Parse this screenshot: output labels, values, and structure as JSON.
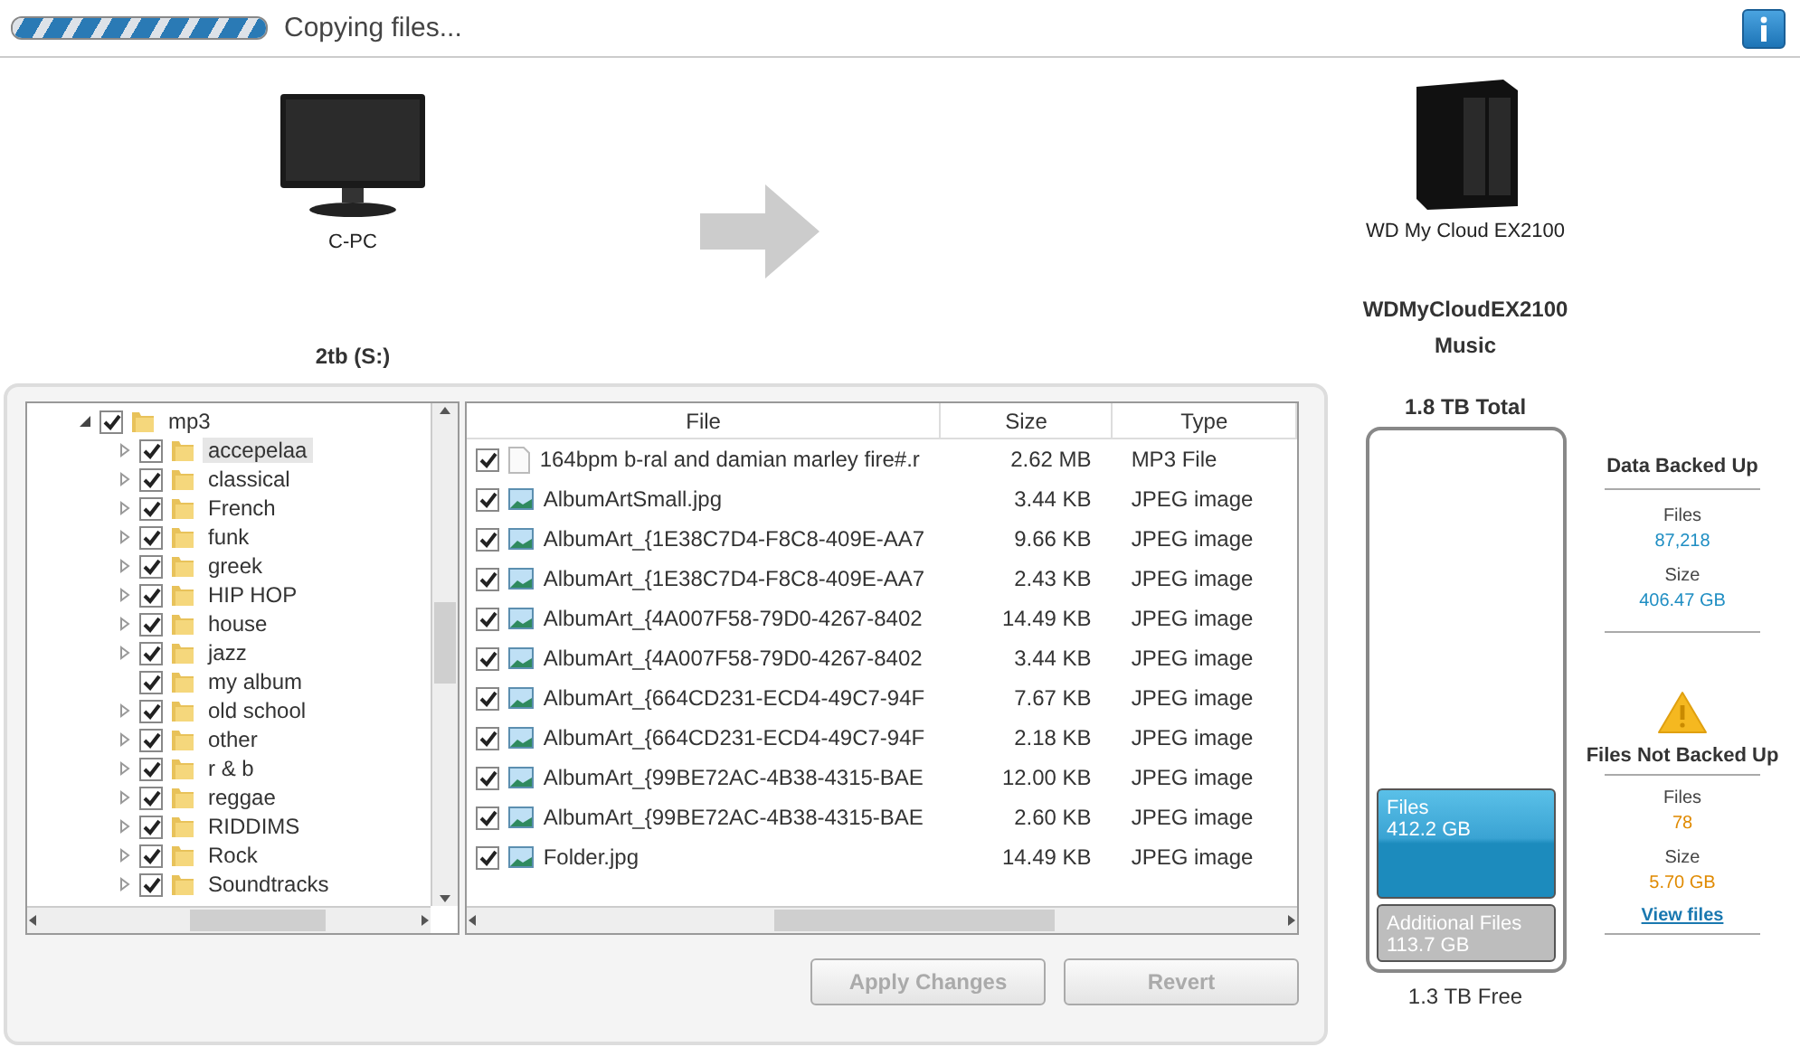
{
  "status": {
    "text": "Copying files...",
    "level": 1
  },
  "source": {
    "name": "C-PC",
    "drive": "2tb (S:)"
  },
  "target": {
    "name": "WD My Cloud EX2100",
    "share_host": "WDMyCloudEX2100",
    "share": "Music"
  },
  "tree": [
    {
      "label": "mp3",
      "checked": true,
      "expanded": true,
      "selected": false,
      "children": [
        {
          "label": "accepelaa",
          "checked": true,
          "expandable": true,
          "selected": true
        },
        {
          "label": "classical",
          "checked": true,
          "expandable": true,
          "selected": false
        },
        {
          "label": "French",
          "checked": true,
          "expandable": true,
          "selected": false
        },
        {
          "label": "funk",
          "checked": true,
          "expandable": true,
          "selected": false
        },
        {
          "label": "greek",
          "checked": true,
          "expandable": true,
          "selected": false
        },
        {
          "label": "HIP HOP",
          "checked": true,
          "expandable": true,
          "selected": false
        },
        {
          "label": "house",
          "checked": true,
          "expandable": true,
          "selected": false
        },
        {
          "label": "jazz",
          "checked": true,
          "expandable": true,
          "selected": false
        },
        {
          "label": "my album",
          "checked": true,
          "expandable": false,
          "selected": false
        },
        {
          "label": "old school",
          "checked": true,
          "expandable": true,
          "selected": false
        },
        {
          "label": "other",
          "checked": true,
          "expandable": true,
          "selected": false
        },
        {
          "label": "r & b",
          "checked": true,
          "expandable": true,
          "selected": false
        },
        {
          "label": "reggae",
          "checked": true,
          "expandable": true,
          "selected": false
        },
        {
          "label": "RIDDIMS",
          "checked": true,
          "expandable": true,
          "selected": false
        },
        {
          "label": "Rock",
          "checked": true,
          "expandable": true,
          "selected": false
        },
        {
          "label": "Soundtracks",
          "checked": true,
          "expandable": true,
          "selected": false
        }
      ]
    }
  ],
  "table": {
    "columns": [
      "File",
      "Size",
      "Type"
    ],
    "rows": [
      {
        "kind": "audio",
        "checked": true,
        "name": "164bpm b-ral and damian marley fire#.r",
        "size": "2.62 MB",
        "type": "MP3 File"
      },
      {
        "kind": "image",
        "checked": true,
        "name": "AlbumArtSmall.jpg",
        "size": "3.44 KB",
        "type": "JPEG image"
      },
      {
        "kind": "image",
        "checked": true,
        "name": "AlbumArt_{1E38C7D4-F8C8-409E-AA7",
        "size": "9.66 KB",
        "type": "JPEG image"
      },
      {
        "kind": "image",
        "checked": true,
        "name": "AlbumArt_{1E38C7D4-F8C8-409E-AA7",
        "size": "2.43 KB",
        "type": "JPEG image"
      },
      {
        "kind": "image",
        "checked": true,
        "name": "AlbumArt_{4A007F58-79D0-4267-8402",
        "size": "14.49 KB",
        "type": "JPEG image"
      },
      {
        "kind": "image",
        "checked": true,
        "name": "AlbumArt_{4A007F58-79D0-4267-8402",
        "size": "3.44 KB",
        "type": "JPEG image"
      },
      {
        "kind": "image",
        "checked": true,
        "name": "AlbumArt_{664CD231-ECD4-49C7-94F",
        "size": "7.67 KB",
        "type": "JPEG image"
      },
      {
        "kind": "image",
        "checked": true,
        "name": "AlbumArt_{664CD231-ECD4-49C7-94F",
        "size": "2.18 KB",
        "type": "JPEG image"
      },
      {
        "kind": "image",
        "checked": true,
        "name": "AlbumArt_{99BE72AC-4B38-4315-BAE",
        "size": "12.00 KB",
        "type": "JPEG image"
      },
      {
        "kind": "image",
        "checked": true,
        "name": "AlbumArt_{99BE72AC-4B38-4315-BAE",
        "size": "2.60 KB",
        "type": "JPEG image"
      },
      {
        "kind": "image",
        "checked": true,
        "name": "Folder.jpg",
        "size": "14.49 KB",
        "type": "JPEG image"
      }
    ]
  },
  "buttons": [
    {
      "label": "Apply Changes",
      "disabled": true
    },
    {
      "label": "Revert",
      "disabled": true
    }
  ],
  "storage": {
    "total": "1.8 TB Total",
    "free": "1.3 TB Free",
    "segments": [
      {
        "kind": "files",
        "label": "Files",
        "value": "412.2 GB",
        "level": 0.21
      },
      {
        "kind": "additional",
        "label": "Additional Files",
        "value": "113.7 GB",
        "level": 0.11
      }
    ]
  },
  "backed_up": {
    "title": "Data Backed Up",
    "files_label": "Files",
    "files": "87,218",
    "size_label": "Size",
    "size": "406.47 GB"
  },
  "not_backed_up": {
    "title": "Files Not Backed Up",
    "files_label": "Files",
    "files": "78",
    "size_label": "Size",
    "size": "5.70 GB",
    "link": "View files"
  }
}
